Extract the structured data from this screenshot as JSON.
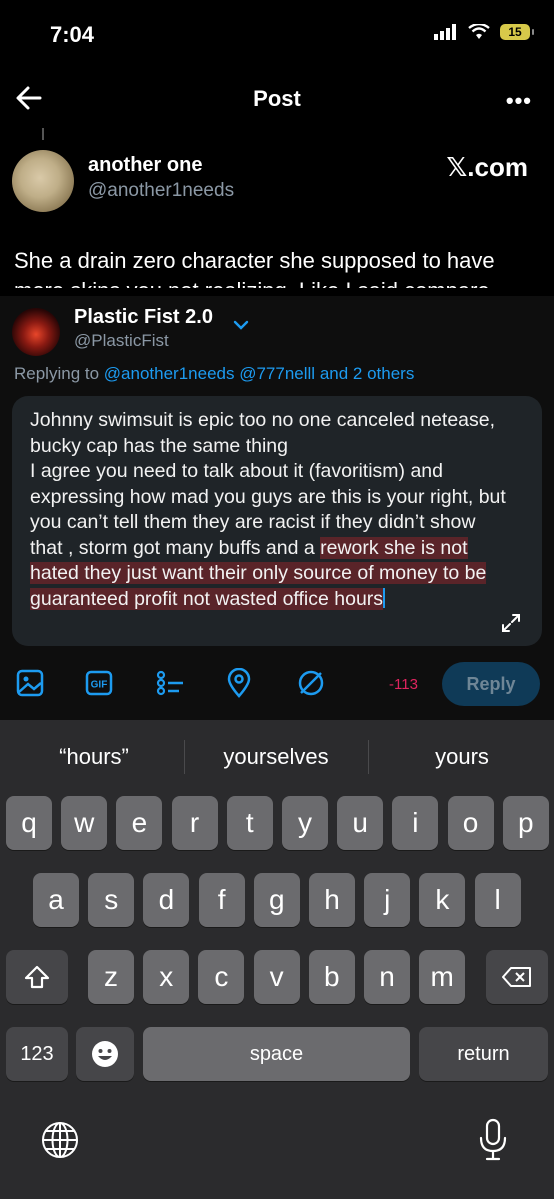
{
  "status_bar": {
    "time": "7:04",
    "battery": "15"
  },
  "header": {
    "title": "Post",
    "more": "•••"
  },
  "original_post": {
    "name": "another one",
    "handle": "@another1needs",
    "source": "𝕏.com",
    "text": "She a drain zero character she supposed to have more skins you not realizing. Like I said compare"
  },
  "reply": {
    "name": "Plastic Fist 2.0",
    "handle": "@PlasticFist",
    "replying_prefix": "Replying to",
    "replying_mentions": "@another1needs @777nelll",
    "replying_suffix": "and 2 others",
    "text_plain": "Johnny swimsuit is epic too no one canceled netease, bucky cap has the same thing\nI agree you need to talk about it (favoritism) and expressing how mad you guys are this is your right, but you can’t tell them they are racist if they didn’t show that , storm got many buffs and a ",
    "text_highlighted": "rework she is not hated they just want their only source of money to be guaranteed profit not wasted office hours"
  },
  "toolbar": {
    "counter": "-113",
    "reply_label": "Reply"
  },
  "keyboard": {
    "suggestions": [
      "“hours”",
      "yourselves",
      "yours"
    ],
    "row1": [
      "q",
      "w",
      "e",
      "r",
      "t",
      "y",
      "u",
      "i",
      "o",
      "p"
    ],
    "row2": [
      "a",
      "s",
      "d",
      "f",
      "g",
      "h",
      "j",
      "k",
      "l"
    ],
    "row3": [
      "z",
      "x",
      "c",
      "v",
      "b",
      "n",
      "m"
    ],
    "numbers_label": "123",
    "space_label": "space",
    "return_label": "return"
  },
  "colors": {
    "accent": "#1d9bf0",
    "highlight": "#5a2429",
    "counter": "#e0245e"
  }
}
